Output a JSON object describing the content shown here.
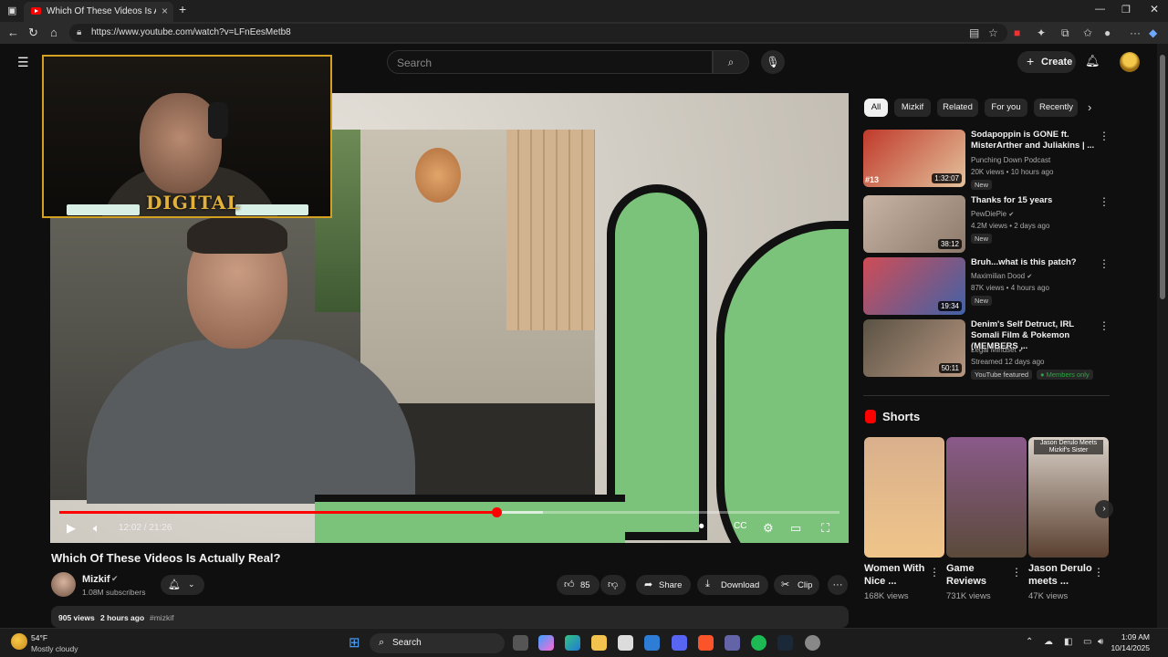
{
  "browser": {
    "tab_title": "Which Of These Videos Is Actually Real? - YouTube",
    "url": "https://www.youtube.com/watch?v=LFnEesMetb8"
  },
  "youtube": {
    "search_placeholder": "Search",
    "create_label": "Create"
  },
  "player": {
    "current_time": "12:02",
    "duration": "21:26",
    "time_display": "12:02 / 21:26",
    "played_fraction": 0.56,
    "buffered_fraction": 0.62,
    "overlay_logo": "DIGITAL"
  },
  "video": {
    "title": "Which Of These Videos Is Actually Real?",
    "channel": "Mizkif",
    "subscribers": "1.08M subscribers",
    "likes": "85",
    "share_label": "Share",
    "download_label": "Download",
    "clip_label": "Clip",
    "views": "905 views",
    "posted": "2 hours ago",
    "hashtag": "#mizkif"
  },
  "chips": [
    "All",
    "Mizkif",
    "Related",
    "For you",
    "Recently"
  ],
  "recommendations": [
    {
      "title": "Sodapoppin is GONE ft. MisterArther and Juliakins | ...",
      "channel": "Punching Down Podcast",
      "meta": "20K views • 10 hours ago",
      "badge": "New",
      "duration": "1:32:07",
      "episode": "#13",
      "colors": [
        "#c0392b",
        "#e3c29b"
      ]
    },
    {
      "title": "Thanks for 15 years",
      "channel": "PewDiePie",
      "meta": "4.2M views • 2 days ago",
      "badge": "New",
      "duration": "38:12",
      "colors": [
        "#c8b4a4",
        "#8d7a6b"
      ]
    },
    {
      "title": "Bruh...what is this patch?",
      "channel": "Maximilian Dood",
      "meta": "87K views • 4 hours ago",
      "badge": "New",
      "duration": "19:34",
      "colors": [
        "#d04c55",
        "#4062a8"
      ]
    },
    {
      "title": "Denim's Self Detruct, IRL Somali Film & Pokemon (MEMBERS ...",
      "channel": "Legal Mindset",
      "meta": "Streamed 12 days ago",
      "badge": "YouTube featured",
      "badge2": "Members only",
      "duration": "50:11",
      "colors": [
        "#5a5244",
        "#b79680"
      ]
    }
  ],
  "shorts": {
    "heading": "Shorts",
    "items": [
      {
        "title": "Women With Nice ...",
        "views": "168K views",
        "colors": [
          "#d9b08c",
          "#f0c58a"
        ]
      },
      {
        "title": "Game Reviews",
        "views": "731K views",
        "colors": [
          "#8a5a8a",
          "#5b4a3a"
        ]
      },
      {
        "title": "Jason Derulo meets ...",
        "views": "47K views",
        "overlay": "Jason Derulo Meets Mizkif's Sister",
        "colors": [
          "#d8cfc6",
          "#5a4030"
        ]
      }
    ]
  },
  "taskbar": {
    "temperature": "54°F",
    "weather": "Mostly cloudy",
    "search_label": "Search",
    "time": "1:09 AM",
    "date": "10/14/2025"
  },
  "colors": {
    "accent": "#ff0000",
    "background": "#0f0f0f",
    "chip_bg": "#272727"
  }
}
